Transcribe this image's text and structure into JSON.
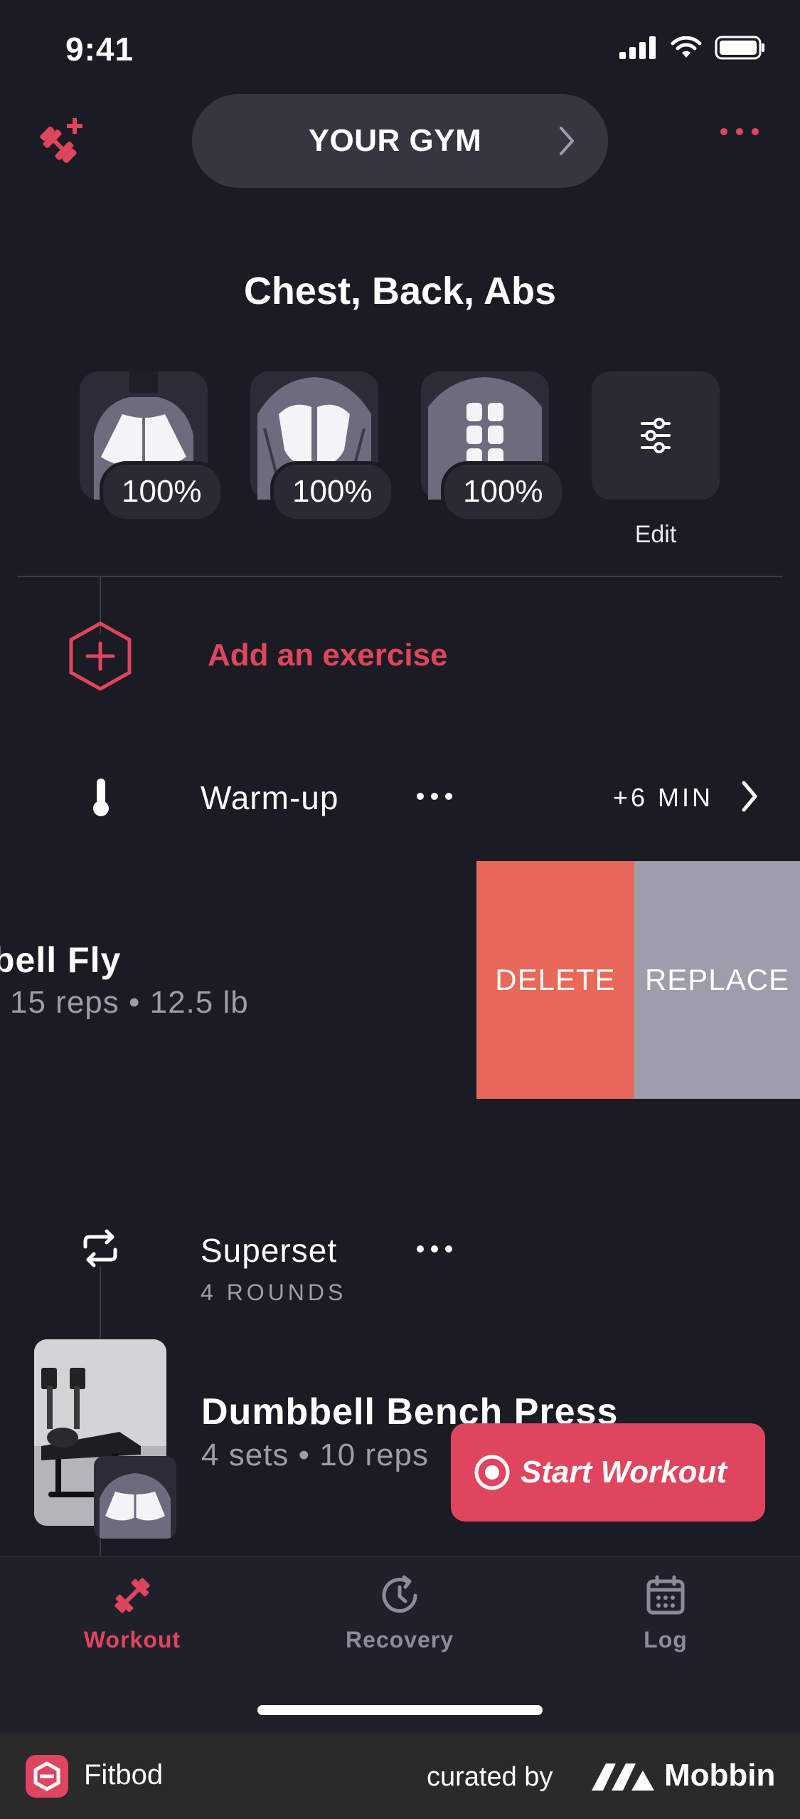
{
  "status_bar": {
    "time": "9:41"
  },
  "header": {
    "gym_label": "YOUR GYM",
    "add_workout_icon": "dumbbell-plus-icon",
    "more_icon": "more-horizontal-icon"
  },
  "workout": {
    "title": "Chest, Back, Abs",
    "muscles": [
      {
        "name": "chest",
        "recovery": "100%"
      },
      {
        "name": "back",
        "recovery": "100%"
      },
      {
        "name": "abs",
        "recovery": "100%"
      }
    ],
    "edit_label": "Edit"
  },
  "add_exercise_label": "Add an exercise",
  "warmup": {
    "label": "Warm-up",
    "duration": "+6 MIN"
  },
  "swiped_exercise": {
    "name": "bell Fly",
    "detail": "15 reps • 12.5 lb",
    "delete_label": "DELETE",
    "replace_label": "REPLACE"
  },
  "superset": {
    "label": "Superset",
    "rounds": "4 ROUNDS"
  },
  "exercise": {
    "name": "Dumbbell Bench Press",
    "detail": "4 sets • 10 reps"
  },
  "start_button_label": "Start Workout",
  "tabs": [
    {
      "label": "Workout",
      "icon": "dumbbell-icon",
      "active": true
    },
    {
      "label": "Recovery",
      "icon": "recovery-clock-icon",
      "active": false
    },
    {
      "label": "Log",
      "icon": "calendar-icon",
      "active": false
    }
  ],
  "footer": {
    "app_name": "Fitbod",
    "curated_by": "curated by",
    "brand": "Mobbin"
  },
  "colors": {
    "background": "#1b1b24",
    "accent": "#e0455e",
    "delete": "#e8685a",
    "replace": "#9d9dab"
  }
}
